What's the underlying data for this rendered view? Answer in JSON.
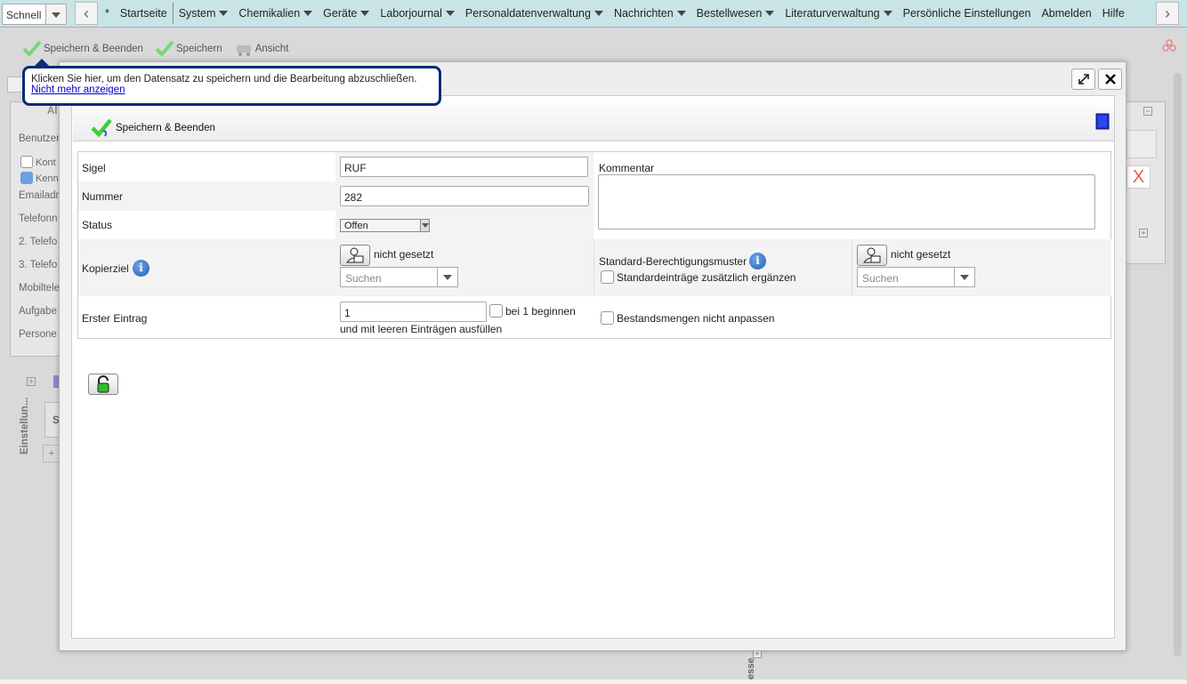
{
  "topbar": {
    "quick_label": "Schnell",
    "menu": [
      {
        "label": "*",
        "arrow": false
      },
      {
        "label": "Startseite",
        "arrow": false
      },
      {
        "label": "System",
        "arrow": true
      },
      {
        "label": "Chemikalien",
        "arrow": true
      },
      {
        "label": "Geräte",
        "arrow": true
      },
      {
        "label": "Laborjournal",
        "arrow": true
      },
      {
        "label": "Personaldatenverwaltung",
        "arrow": true
      },
      {
        "label": "Nachrichten",
        "arrow": true
      },
      {
        "label": "Bestellwesen",
        "arrow": true
      },
      {
        "label": "Literaturverwaltung",
        "arrow": true
      },
      {
        "label": "Persönliche Einstellungen",
        "arrow": false
      },
      {
        "label": "Abmelden",
        "arrow": false
      },
      {
        "label": "Hilfe",
        "arrow": false
      }
    ]
  },
  "toolbar": {
    "save_close_label": "Speichern & Beenden",
    "save_label": "Speichern",
    "view_label": "Ansicht"
  },
  "background": {
    "section_label": "Al",
    "rows": [
      "Benutzer",
      "Kont",
      "Kenn",
      "Emailadr",
      "Telefonn",
      "2. Telefo",
      "3. Telefo",
      "Mobiltele",
      "Aufgabe",
      "Persone"
    ],
    "vertical_label": "Einstellun...",
    "bottom_vertical_label": "esse",
    "small_s": "S",
    "plus": "+"
  },
  "tooltip": {
    "text": "Klicken Sie hier, um den Datensatz zu speichern und die Bearbeitung abzuschließen.",
    "link": "Nicht mehr anzeigen"
  },
  "dialog": {
    "toolbar_save_close": "Speichern & Beenden",
    "form": {
      "sigel_label": "Sigel",
      "sigel_value": "RUF",
      "nummer_label": "Nummer",
      "nummer_value": "282",
      "status_label": "Status",
      "status_value": "Offen",
      "kommentar_label": "Kommentar",
      "kommentar_value": "",
      "kopierziel_label": "Kopierziel",
      "kopierziel_value": "nicht gesetzt",
      "kopierziel_search": "Suchen",
      "std_berechtigung_label": "Standard-Berechtigungsmuster",
      "std_berechtigung_value": "nicht gesetzt",
      "std_berechtigung_search": "Suchen",
      "std_eintraege_label": "Standardeinträge zusätzlich ergänzen",
      "erster_eintrag_label": "Erster Eintrag",
      "erster_eintrag_value": "1",
      "bei1_label": "bei 1 beginnen",
      "leere_label": "und mit leeren Einträgen ausfüllen",
      "bestand_label": "Bestandsmengen nicht anpassen"
    }
  },
  "colors": {
    "topbar": "#c9e4e5",
    "tooltip_border": "#0b2a7a",
    "check_green": "#3ccf3c",
    "info_blue": "#1f5fb0"
  }
}
